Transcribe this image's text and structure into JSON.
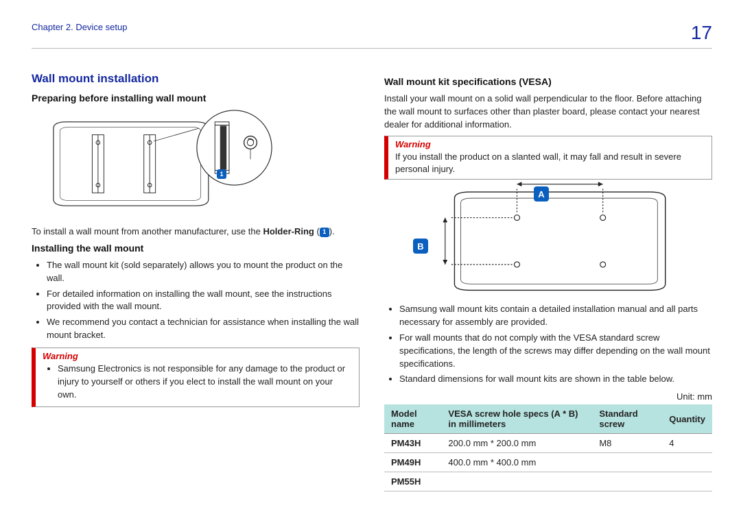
{
  "header": {
    "chapter_label": "Chapter 2. Device setup",
    "page_number": "17"
  },
  "left": {
    "section_title": "Wall mount installation",
    "sub1": "Preparing before installing wall mount",
    "fig1_ref_label": "1",
    "caption_pre": "To install a wall mount from another manufacturer, use the ",
    "caption_bold": "Holder-Ring",
    "caption_post": " (",
    "caption_ref": "1",
    "caption_end": ").",
    "sub2": "Installing the wall mount",
    "bullets": [
      "The wall mount kit (sold separately) allows you to mount the product on the wall.",
      "For detailed information on installing the wall mount, see the instructions provided with the wall mount.",
      "We recommend you contact a technician for assistance when installing the wall mount bracket."
    ],
    "warning": {
      "title": "Warning",
      "items": [
        "Samsung Electronics is not responsible for any damage to the product or injury to yourself or others if you elect to install the wall mount on your own."
      ]
    }
  },
  "right": {
    "sub1": "Wall mount kit specifications (VESA)",
    "intro": "Install your wall mount on a solid wall perpendicular to the floor. Before attaching the wall mount to surfaces other than plaster board, please contact your nearest dealer for additional information.",
    "warning": {
      "title": "Warning",
      "text": "If you install the product on a slanted wall, it may fall and result in severe personal injury."
    },
    "fig_labels": {
      "A": "A",
      "B": "B"
    },
    "bullets": [
      "Samsung wall mount kits contain a detailed installation manual and all parts necessary for assembly are provided.",
      "For wall mounts that do not comply with the VESA standard screw specifications, the length of the screws may differ depending on the wall mount specifications.",
      "Standard dimensions for wall mount kits are shown in the table below."
    ],
    "unit_label": "Unit: mm",
    "table": {
      "headers": [
        "Model name",
        "VESA screw hole specs (A * B) in millimeters",
        "Standard screw",
        "Quantity"
      ],
      "rows": [
        {
          "model": "PM43H",
          "spec": "200.0 mm * 200.0 mm",
          "screw": "M8",
          "qty": "4"
        },
        {
          "model": "PM49H",
          "spec": "400.0 mm * 400.0 mm",
          "screw": "",
          "qty": ""
        },
        {
          "model": "PM55H",
          "spec": "",
          "screw": "",
          "qty": ""
        }
      ]
    }
  }
}
